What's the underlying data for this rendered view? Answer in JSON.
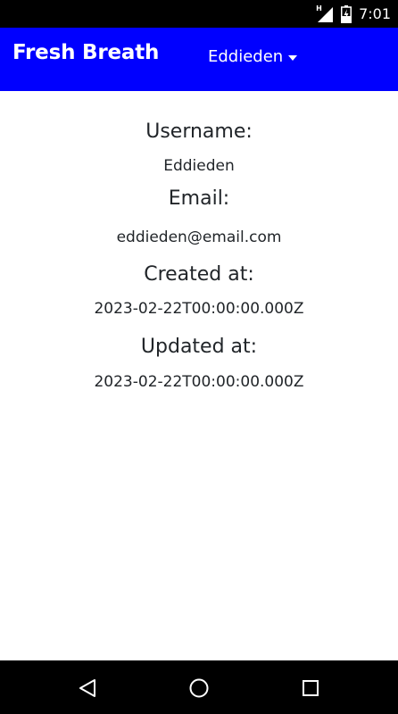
{
  "status_bar": {
    "network_type": "H",
    "time": "7:01",
    "icons": [
      "signal-icon",
      "battery-charging-icon"
    ]
  },
  "app_bar": {
    "brand": "Fresh Breath",
    "user_menu_label": "Eddieden",
    "background_color": "#0000ff"
  },
  "profile": {
    "username_label": "Username:",
    "username_value": "Eddieden",
    "email_label": "Email:",
    "email_value": "eddieden@email.com",
    "created_label": "Created at:",
    "created_value": "2023-02-22T00:00:00.000Z",
    "updated_label": "Updated at:",
    "updated_value": "2023-02-22T00:00:00.000Z"
  },
  "nav_bar": {
    "buttons": [
      "back-icon",
      "home-icon",
      "recents-icon"
    ]
  }
}
